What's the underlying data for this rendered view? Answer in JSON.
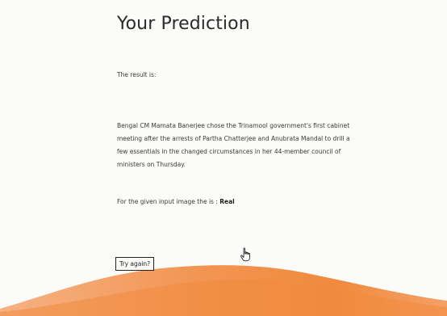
{
  "header": {
    "title": "Your Prediction"
  },
  "result": {
    "label": "The result is:",
    "text": "Bengal CM Mamata Banerjee chose the Trinamool government's first cabinet meeting after the arrests of Partha Chatterjee and Anubrata Mandal to drill a few essentials in the changed circumstances in her 44-member council of ministers on Thursday.",
    "verdict_prefix": "For the given input image the is : ",
    "verdict_value": "Real"
  },
  "actions": {
    "try_again_label": "Try again?"
  },
  "icons": {
    "cursor": "hand-pointer-icon"
  },
  "colors": {
    "background": "#fbfbf9",
    "wave_light": "#f5a06a",
    "wave_dark": "#f08a3e"
  }
}
